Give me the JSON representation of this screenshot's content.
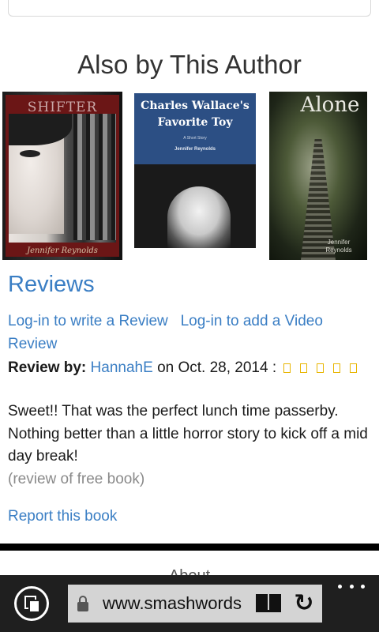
{
  "section": {
    "title": "Also by This Author"
  },
  "books": [
    {
      "title": "SHIFTER",
      "author": "Jennifer Reynolds"
    },
    {
      "title": "Charles Wallace's Favorite Toy",
      "subtitle": "A Short Story",
      "author": "Jennifer Reynolds"
    },
    {
      "title": "Alone",
      "author": "Jennifer Reynolds"
    }
  ],
  "reviews": {
    "heading": "Reviews",
    "write_link": "Log-in to write a Review",
    "video_link": "Log-in to add a Video Review",
    "review_by_label": "Review by:",
    "reviewer": "HannahE",
    "date_text": "on Oct. 28, 2014 :",
    "rating": 5,
    "rating_max": 5,
    "body": "Sweet!! That was the perfect lunch time passerby. Nothing better than a little horror story to kick off a mid day break!",
    "note": "(review of free book)",
    "report_link": "Report this book"
  },
  "about_peek": "About",
  "browser": {
    "url": "www.smashwords.com",
    "icons": [
      "tabs-icon",
      "lock-icon",
      "reading-view-icon",
      "refresh-icon",
      "more-icon"
    ]
  },
  "colors": {
    "link": "#3a7ec4",
    "star": "#e8b500",
    "toolbar": "#1f1f1f"
  }
}
